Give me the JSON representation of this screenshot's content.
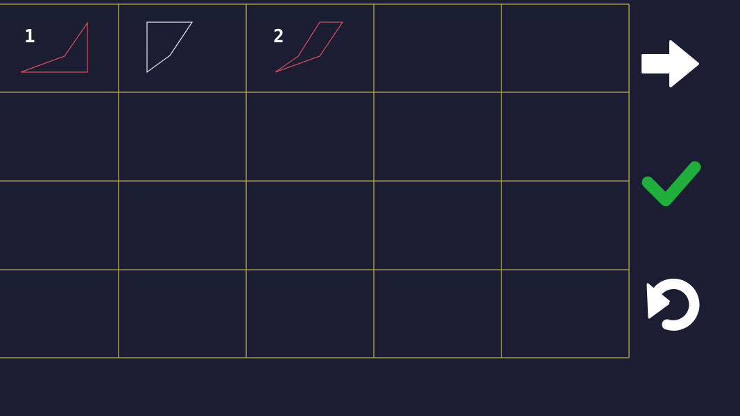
{
  "colors": {
    "background": "#1b1d33",
    "grid_line": "#bdb04a",
    "shape_red": "#d9505a",
    "shape_white": "#e8e8f0",
    "next_icon": "#ffffff",
    "confirm_icon": "#1eb03a",
    "undo_icon": "#ffffff"
  },
  "grid": {
    "rows": 4,
    "cols": 5
  },
  "cells": [
    {
      "row": 0,
      "col": 0,
      "label": "1",
      "shape": "shape-1",
      "color": "red"
    },
    {
      "row": 0,
      "col": 1,
      "label": "",
      "shape": "shape-2",
      "color": "white"
    },
    {
      "row": 0,
      "col": 2,
      "label": "2",
      "shape": "shape-3",
      "color": "red"
    }
  ],
  "controls": {
    "next": {
      "icon": "arrow-right-icon"
    },
    "confirm": {
      "icon": "checkmark-icon"
    },
    "undo": {
      "icon": "undo-icon"
    }
  }
}
